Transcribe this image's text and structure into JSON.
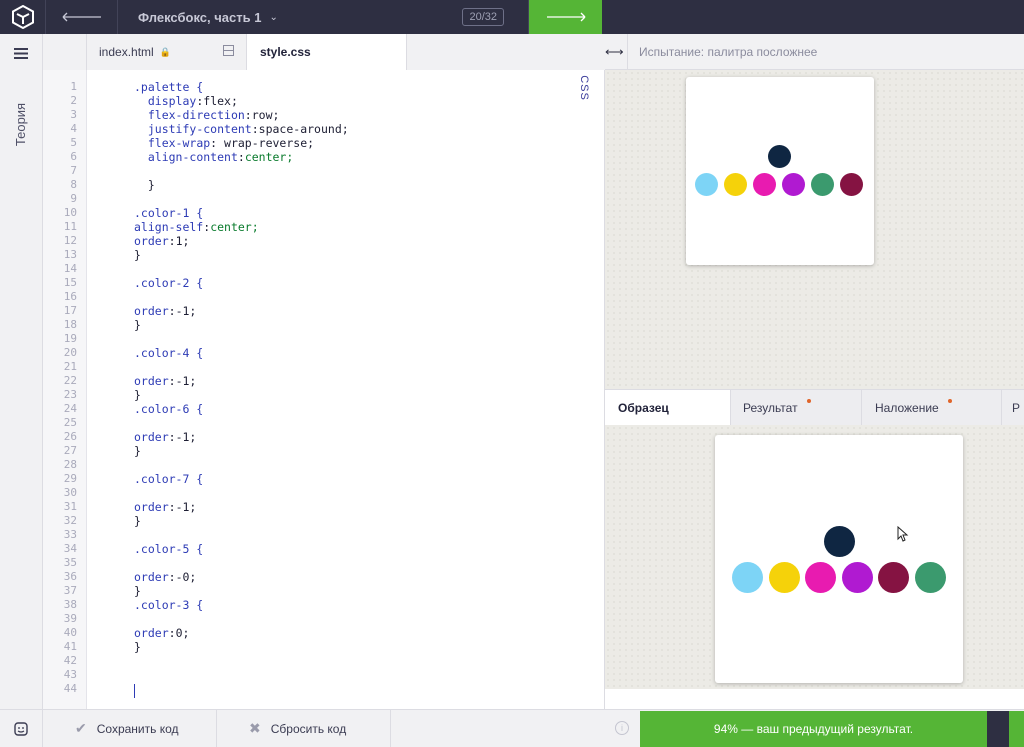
{
  "topbar": {
    "course_title": "Флексбокс, часть 1",
    "counter": "20/32",
    "logo_icon": "cube-logo-icon",
    "back_icon": "arrow-left-icon",
    "next_icon": "arrow-right-icon",
    "accent_color": "#55b536"
  },
  "sidebar": {
    "theory_label": "Теория",
    "menu_icon": "hamburger-icon"
  },
  "editor": {
    "tabs": [
      {
        "label": "index.html",
        "locked": true
      },
      {
        "label": "style.css",
        "active": true
      }
    ],
    "language_badge": "CSS",
    "line_numbers": [
      "1",
      "2",
      "3",
      "4",
      "5",
      "6",
      "7",
      "8",
      "9",
      "10",
      "11",
      "12",
      "13",
      "14",
      "15",
      "16",
      "17",
      "18",
      "19",
      "20",
      "21",
      "22",
      "23",
      "24",
      "25",
      "26",
      "27",
      "28",
      "29",
      "30",
      "31",
      "32",
      "33",
      "34",
      "35",
      "36",
      "37",
      "38",
      "39",
      "40",
      "41",
      "42",
      "43",
      "44"
    ],
    "lines": [
      ".palette {",
      "  display:flex;",
      "  flex-direction:row;",
      "  justify-content:space-around;",
      "  flex-wrap: wrap-reverse;",
      "  align-content:center;",
      "",
      "  }",
      "",
      ".color-1 {",
      "align-self:center;",
      "order:1;",
      "}",
      "",
      ".color-2 {",
      "",
      "order:-1;",
      "}",
      "",
      ".color-4 {",
      "",
      "order:-1;",
      "}",
      ".color-6 {",
      "",
      "order:-1;",
      "}",
      "",
      ".color-7 {",
      "",
      "order:-1;",
      "}",
      "",
      ".color-5 {",
      "",
      "order:-0;",
      "}",
      ".color-3 {",
      "",
      "order:0;",
      "}",
      "",
      "",
      ""
    ]
  },
  "footer": {
    "save_label": "Сохранить код",
    "reset_label": "Сбросить код",
    "result_text": "94% — ваш предыдущий результат."
  },
  "preview": {
    "title": "Испытание: палитра посложнее",
    "tabs": [
      {
        "label": "Образец",
        "active": true
      },
      {
        "label": "Результат",
        "marked": true
      },
      {
        "label": "Наложение",
        "marked": true
      },
      {
        "label": "Р"
      }
    ],
    "result_dots": {
      "top": "#0f2642",
      "row": [
        "#7dd4f6",
        "#f5d20a",
        "#e81bb0",
        "#b01ad1",
        "#3b9a6e",
        "#851342"
      ]
    },
    "sample_dots": {
      "top": "#0f2642",
      "row": [
        "#7dd4f6",
        "#f5d20a",
        "#e81bb0",
        "#b01ad1",
        "#851342",
        "#3b9a6e"
      ]
    }
  }
}
